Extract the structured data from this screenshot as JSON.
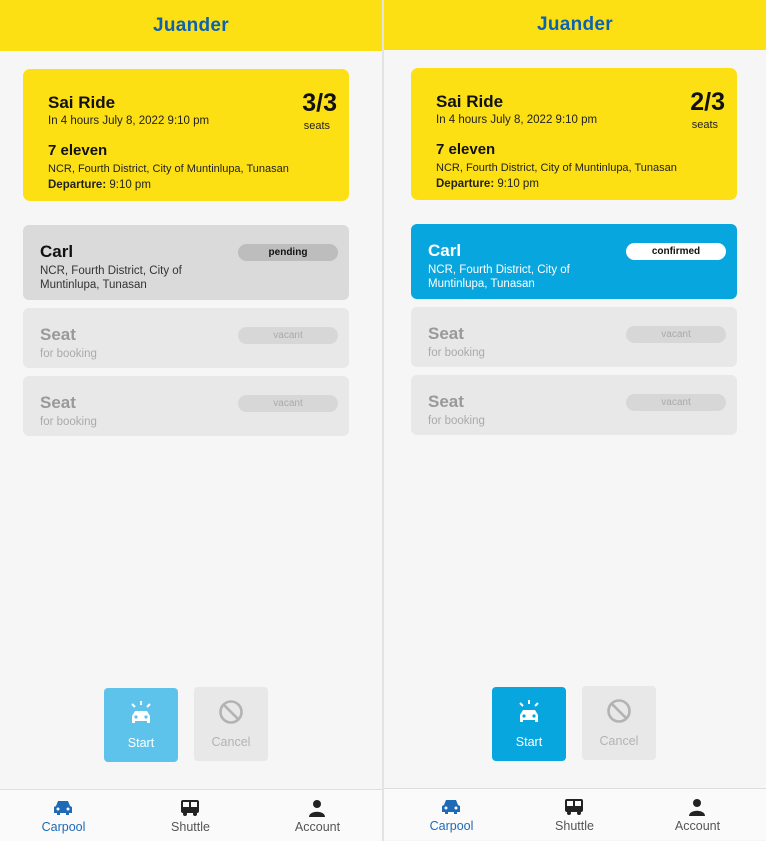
{
  "app": {
    "title": "Juander"
  },
  "screens": [
    {
      "ride": {
        "name": "Sai Ride",
        "time": "In 4 hours July 8, 2022 9:10 pm",
        "seat_count": "3/3",
        "seat_unit": "seats",
        "destination": "7 eleven",
        "address": "NCR, Fourth District, City of Muntinlupa, Tunasan",
        "departure_label": "Departure:",
        "departure_time": "9:10 pm"
      },
      "seats": [
        {
          "title": "Carl",
          "subtitle": "NCR, Fourth District, City of Muntinlupa, Tunasan",
          "status": "pending"
        },
        {
          "title": "Seat",
          "subtitle": "for booking",
          "status": "vacant"
        },
        {
          "title": "Seat",
          "subtitle": "for booking",
          "status": "vacant"
        }
      ],
      "actions": {
        "start": "Start",
        "cancel": "Cancel"
      },
      "nav": [
        {
          "label": "Carpool",
          "icon": "car-icon",
          "active": true
        },
        {
          "label": "Shuttle",
          "icon": "bus-icon",
          "active": false
        },
        {
          "label": "Account",
          "icon": "person-icon",
          "active": false
        }
      ]
    },
    {
      "ride": {
        "name": "Sai Ride",
        "time": "In 4 hours July 8, 2022 9:10 pm",
        "seat_count": "2/3",
        "seat_unit": "seats",
        "destination": "7 eleven",
        "address": "NCR, Fourth District, City of Muntinlupa, Tunasan",
        "departure_label": "Departure:",
        "departure_time": "9:10 pm"
      },
      "seats": [
        {
          "title": "Carl",
          "subtitle": "NCR, Fourth District, City of Muntinlupa, Tunasan",
          "status": "confirmed"
        },
        {
          "title": "Seat",
          "subtitle": "for booking",
          "status": "vacant"
        },
        {
          "title": "Seat",
          "subtitle": "for booking",
          "status": "vacant"
        }
      ],
      "actions": {
        "start": "Start",
        "cancel": "Cancel"
      },
      "nav": [
        {
          "label": "Carpool",
          "icon": "car-icon",
          "active": true
        },
        {
          "label": "Shuttle",
          "icon": "bus-icon",
          "active": false
        },
        {
          "label": "Account",
          "icon": "person-icon",
          "active": false
        }
      ]
    }
  ],
  "colors": {
    "brand_yellow": "#fde014",
    "brand_blue": "#0b62b3",
    "confirmed_blue": "#08a6de",
    "start_light_blue": "#5ec3eb"
  }
}
